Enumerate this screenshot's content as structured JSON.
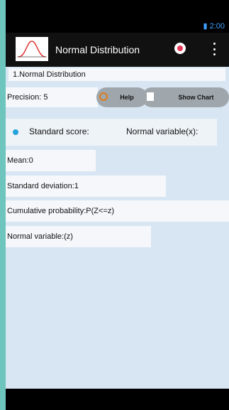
{
  "status": {
    "time": "2:00"
  },
  "app": {
    "title": "Normal Distribution"
  },
  "dropdown": {
    "selected": "1.Normal Distribution"
  },
  "precision": {
    "label": "Precision: 5"
  },
  "buttons": {
    "help": "Help",
    "show_chart": "Show Chart"
  },
  "radio": {
    "standard_score": "Standard score:",
    "normal_variable": "Normal variable(x):"
  },
  "fields": {
    "mean": "Mean:0",
    "std_dev": "Standard deviation:1",
    "cumulative": "Cumulative probability:P(Z<=z)",
    "normal_variable": "Normal variable:(z)"
  },
  "colors": {
    "accent": "#23a3da",
    "record": "#e53b5a",
    "background": "#d8e6f3"
  }
}
